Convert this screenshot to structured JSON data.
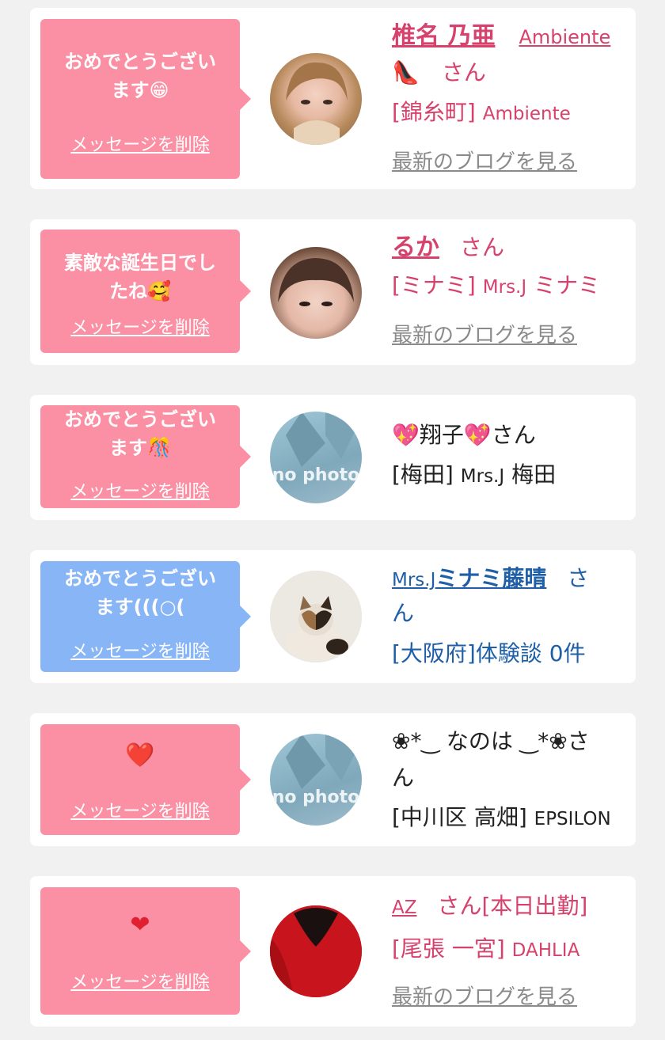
{
  "common": {
    "delete_label": "メッセージを削除",
    "blog_label": "最新のブログを見る",
    "san": "さん",
    "no_photo": "no photo"
  },
  "cards": [
    {
      "message_lines": [
        "おめでとうござい",
        "ます😁"
      ],
      "name": "椎名 乃亜",
      "shop_link": "Ambiente",
      "name_suffix": "👠　さん",
      "area": "[錦糸町]",
      "shop": "Ambiente",
      "blog": "最新のブログを見る",
      "avatar": "portrait-photo"
    },
    {
      "message_lines": [
        "素敵な誕生日でし",
        "たね🥰"
      ],
      "name": "るか",
      "name_suffix": "さん",
      "area": "[ミナミ]",
      "shop_prefix": "Mrs.J",
      "shop": "ミナミ",
      "blog": "最新のブログを見る",
      "avatar": "portrait-photo"
    },
    {
      "message_lines": [
        "おめでとうござい",
        "ます🎊"
      ],
      "name": "💖翔子💖さん",
      "area": "[梅田]",
      "shop_prefix": "Mrs.J",
      "shop": "梅田",
      "avatar": "no-photo"
    },
    {
      "message_lines": [
        "おめでとうござい",
        "ます(((○("
      ],
      "name_prefix": "Mrs.J",
      "name": "ミナミ藤晴",
      "name_suffix": "さ",
      "name_suffix2": "ん",
      "area": "[大阪府]体験談",
      "count": "0件",
      "avatar": "cat-photo"
    },
    {
      "message_lines": [
        "❤️"
      ],
      "name": "❀*‿ なのは ‿*❀さ",
      "name_suffix2": "ん",
      "area": "[中川区 高畑]",
      "shop": "EPSILON",
      "avatar": "no-photo"
    },
    {
      "message_lines": [
        "❤"
      ],
      "name": "AZ",
      "name_suffix": "さん[本日出勤]",
      "area": "[尾張 一宮]",
      "shop": "DAHLIA",
      "blog": "最新のブログを見る",
      "avatar": "heart-photo"
    }
  ],
  "colors": {
    "pink_bubble": "#fb8fa3",
    "blue_bubble": "#87b5f6",
    "pink_text": "#d6426c",
    "blue_text": "#1f5fa8"
  }
}
